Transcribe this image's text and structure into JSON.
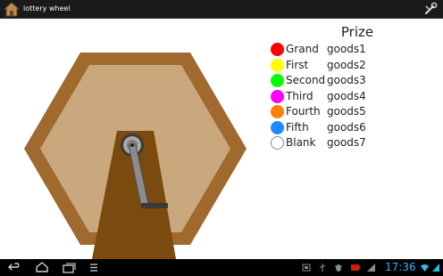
{
  "action_bar": {
    "title": "lottery wheel",
    "icon": "wooden-house-icon",
    "settings_icon": "wrench-icon"
  },
  "prize_panel": {
    "title": "Prize",
    "items": [
      {
        "name": "Grand",
        "goods": "goods1",
        "color": "#ff0000"
      },
      {
        "name": "First",
        "goods": "goods2",
        "color": "#ffff00"
      },
      {
        "name": "Second",
        "goods": "goods3",
        "color": "#00ff00"
      },
      {
        "name": "Third",
        "goods": "goods4",
        "color": "#ff00ff"
      },
      {
        "name": "Fourth",
        "goods": "goods5",
        "color": "#ff8000"
      },
      {
        "name": "Fifth",
        "goods": "goods6",
        "color": "#1a8cff"
      },
      {
        "name": "Blank",
        "goods": "goods7",
        "color": "#ffffff"
      }
    ]
  },
  "wheel": {
    "frame_color": "#a0692e",
    "inner_color": "#c8a87c",
    "stand_color": "#7a4a0e",
    "crank_color": "#8c8c8c"
  },
  "system_bar": {
    "time": "17:36",
    "accent_color": "#33b5e5",
    "nav_icons": [
      "back-icon",
      "home-icon",
      "recent-apps-icon",
      "menu-icon"
    ],
    "status_icons": [
      "screenshot-icon",
      "usb-icon",
      "debug-icon",
      "battery-full-icon",
      "wifi-icon",
      "signal-icon"
    ]
  }
}
